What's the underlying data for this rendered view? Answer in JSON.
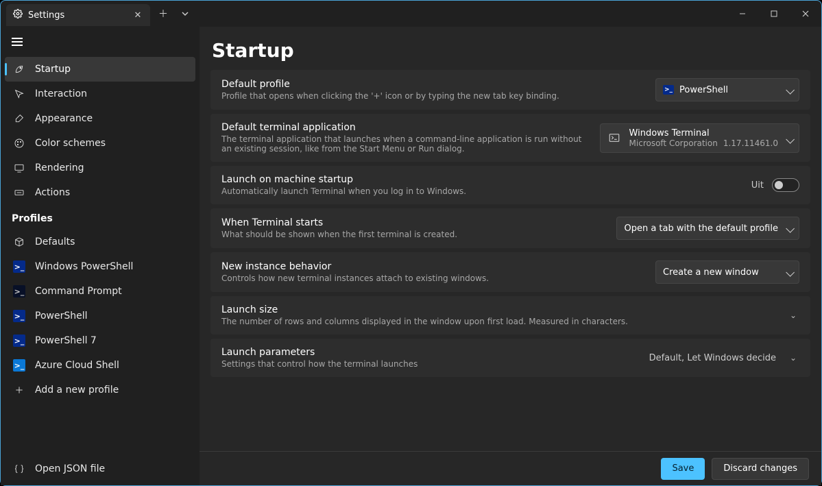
{
  "tab": {
    "title": "Settings"
  },
  "window_controls": {
    "minimize": "—",
    "maximize": "▢",
    "close": "✕"
  },
  "sidebar": {
    "items": [
      {
        "label": "Startup"
      },
      {
        "label": "Interaction"
      },
      {
        "label": "Appearance"
      },
      {
        "label": "Color schemes"
      },
      {
        "label": "Rendering"
      },
      {
        "label": "Actions"
      }
    ],
    "profiles_header": "Profiles",
    "profiles": [
      {
        "label": "Defaults"
      },
      {
        "label": "Windows PowerShell"
      },
      {
        "label": "Command Prompt"
      },
      {
        "label": "PowerShell"
      },
      {
        "label": "PowerShell 7"
      },
      {
        "label": "Azure Cloud Shell"
      },
      {
        "label": "Add a new profile"
      }
    ],
    "open_json": "Open JSON file"
  },
  "page": {
    "title": "Startup",
    "rows": {
      "default_profile": {
        "title": "Default profile",
        "desc": "Profile that opens when clicking the '+' icon or by typing the new tab key binding.",
        "value": "PowerShell"
      },
      "default_app": {
        "title": "Default terminal application",
        "desc": "The terminal application that launches when a command-line application is run without an existing session, like from the Start Menu or Run dialog.",
        "app_name": "Windows Terminal",
        "publisher": "Microsoft Corporation",
        "version": "1.17.11461.0"
      },
      "launch_startup": {
        "title": "Launch on machine startup",
        "desc": "Automatically launch Terminal when you log in to Windows.",
        "state_label": "Uit"
      },
      "when_starts": {
        "title": "When Terminal starts",
        "desc": "What should be shown when the first terminal is created.",
        "value": "Open a tab with the default profile"
      },
      "new_instance": {
        "title": "New instance behavior",
        "desc": "Controls how new terminal instances attach to existing windows.",
        "value": "Create a new window"
      },
      "launch_size": {
        "title": "Launch size",
        "desc": "The number of rows and columns displayed in the window upon first load. Measured in characters."
      },
      "launch_params": {
        "title": "Launch parameters",
        "desc": "Settings that control how the terminal launches",
        "value": "Default, Let Windows decide"
      }
    },
    "footer": {
      "save": "Save",
      "discard": "Discard changes"
    }
  }
}
